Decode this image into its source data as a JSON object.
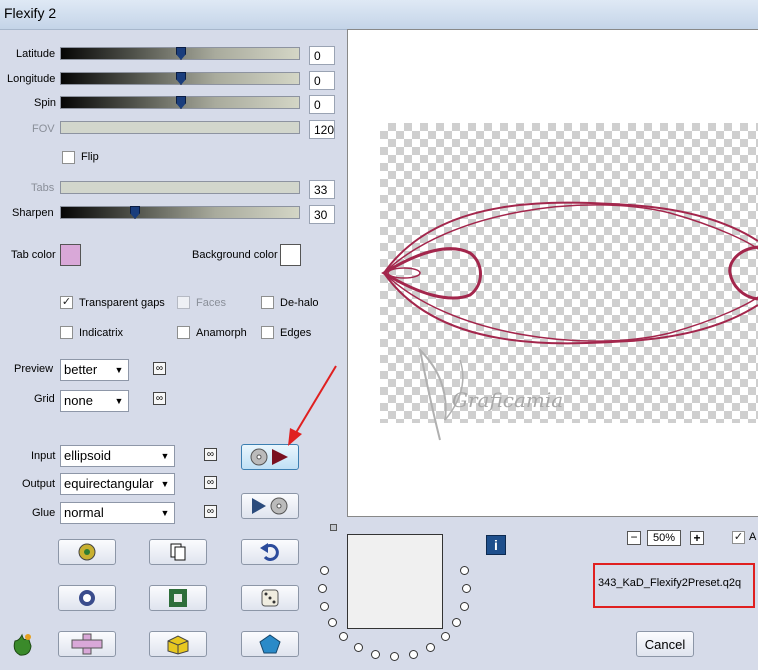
{
  "window": {
    "title": "Flexify 2"
  },
  "sliders": [
    {
      "label": "Latitude",
      "value": "0",
      "enabled": true,
      "level": 0.5
    },
    {
      "label": "Longitude",
      "value": "0",
      "enabled": true,
      "level": 0.5
    },
    {
      "label": "Spin",
      "value": "0",
      "enabled": true,
      "level": 0.5
    },
    {
      "label": "FOV",
      "value": "120",
      "enabled": false
    },
    {
      "label": "Tabs",
      "value": "33",
      "enabled": false
    },
    {
      "label": "Sharpen",
      "value": "30",
      "enabled": true,
      "level": 0.3
    }
  ],
  "flip": {
    "label": "Flip",
    "checked": false
  },
  "colors": {
    "tab_label": "Tab color",
    "tab_value": "#d9a8d8",
    "bg_label": "Background color",
    "bg_value": "#ffffff"
  },
  "options": {
    "transparent_gaps": {
      "label": "Transparent gaps",
      "checked": true
    },
    "faces": {
      "label": "Faces",
      "enabled": false
    },
    "dehalo": {
      "label": "De-halo",
      "checked": false
    },
    "indicatrix": {
      "label": "Indicatrix",
      "checked": false
    },
    "anamorph": {
      "label": "Anamorph",
      "checked": false
    },
    "edges": {
      "label": "Edges",
      "checked": false
    }
  },
  "preview": {
    "label": "Preview",
    "value": "better"
  },
  "grid": {
    "label": "Grid",
    "value": "none"
  },
  "input": {
    "label": "Input",
    "value": "ellipsoid"
  },
  "output": {
    "label": "Output",
    "value": "equirectangular"
  },
  "glue": {
    "label": "Glue",
    "value": "normal"
  },
  "zoom": {
    "value": "50%",
    "zoom_out": "−",
    "zoom_in": "+",
    "auto_label": "A"
  },
  "preset_name": "343_KaD_Flexify2Preset.q2q",
  "cancel_label": "Cancel",
  "watermark_text": "Graficamia",
  "info_glyph": "i",
  "link_glyph": "∞",
  "tool_icons": [
    "settings-ball-icon",
    "copy-icon",
    "undo-icon",
    "lens-icon",
    "square-icon",
    "dice-icon",
    "shape-icon",
    "cross-icon",
    "cube-icon",
    "pentagon-icon"
  ],
  "accent": {
    "curve": "#a3264c",
    "highlight": "#3c7fb1",
    "alert": "#e02020"
  }
}
